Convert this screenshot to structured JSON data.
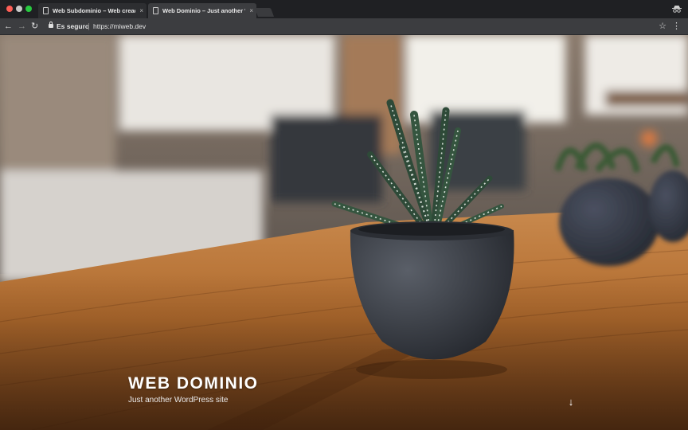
{
  "browser": {
    "tabs": [
      {
        "title": "Web Subdominio – Web creada",
        "active": false
      },
      {
        "title": "Web Dominio – Just another WordPress site",
        "active": true
      }
    ],
    "tab_close_glyph": "×",
    "address": {
      "security_label": "Es seguro",
      "url": "https://miweb.dev"
    },
    "icons": {
      "back": "back-arrow-icon",
      "forward": "forward-arrow-icon",
      "reload": "reload-icon",
      "lock": "lock-icon",
      "star": "bookmark-star-icon",
      "menu": "kebab-menu-icon",
      "incognito": "incognito-icon"
    }
  },
  "hero": {
    "site_title": "WEB DOMINIO",
    "site_description": "Just another WordPress site",
    "scroll_down": "arrow-down-icon"
  },
  "colors": {
    "window_chrome": "#1f2023",
    "toolbar": "#3c3d40",
    "hero_text": "#ffffff",
    "wood": "#b26b2a",
    "pot": "#3d4149"
  }
}
